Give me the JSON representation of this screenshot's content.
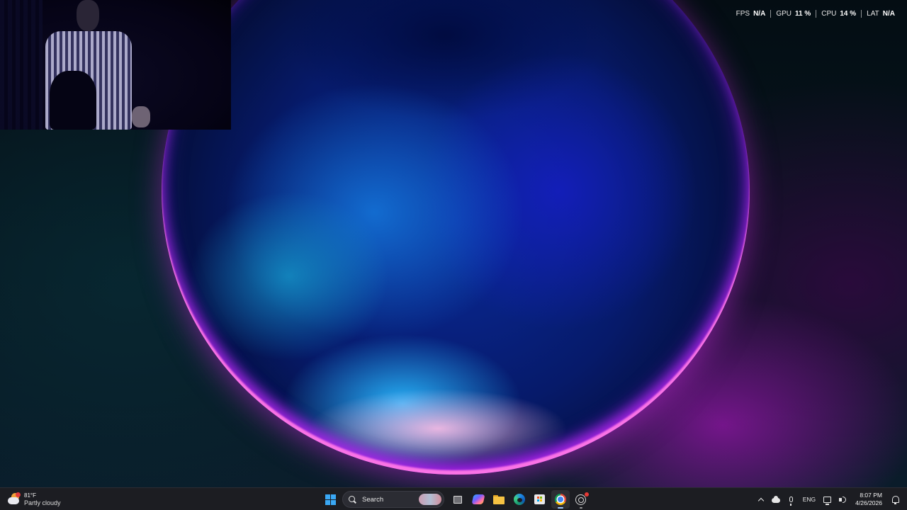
{
  "perf_overlay": {
    "fps": {
      "label": "FPS",
      "value": "N/A"
    },
    "gpu": {
      "label": "GPU",
      "value": "11 %"
    },
    "cpu": {
      "label": "CPU",
      "value": "14 %"
    },
    "lat": {
      "label": "LAT",
      "value": "N/A"
    }
  },
  "weather": {
    "temperature": "81°F",
    "condition": "Partly cloudy",
    "icon": "partly-cloudy-icon"
  },
  "taskbar": {
    "search_label": "Search",
    "apps": [
      {
        "name": "Start",
        "icon": "windows-start-icon"
      },
      {
        "name": "Task View",
        "icon": "task-view-icon"
      },
      {
        "name": "Copilot",
        "icon": "copilot-icon"
      },
      {
        "name": "File Explorer",
        "icon": "folder-icon"
      },
      {
        "name": "Microsoft Edge",
        "icon": "edge-icon"
      },
      {
        "name": "Microsoft Store",
        "icon": "store-icon"
      },
      {
        "name": "Google Chrome",
        "icon": "chrome-icon",
        "active": true
      },
      {
        "name": "OBS",
        "icon": "obs-icon",
        "recording": true
      }
    ]
  },
  "systray": {
    "language": "ENG",
    "time": "8:07 PM",
    "date": "4/26/2026"
  },
  "colors": {
    "taskbar_bg": "#1c1d22",
    "accent": "#3aa8f5"
  }
}
